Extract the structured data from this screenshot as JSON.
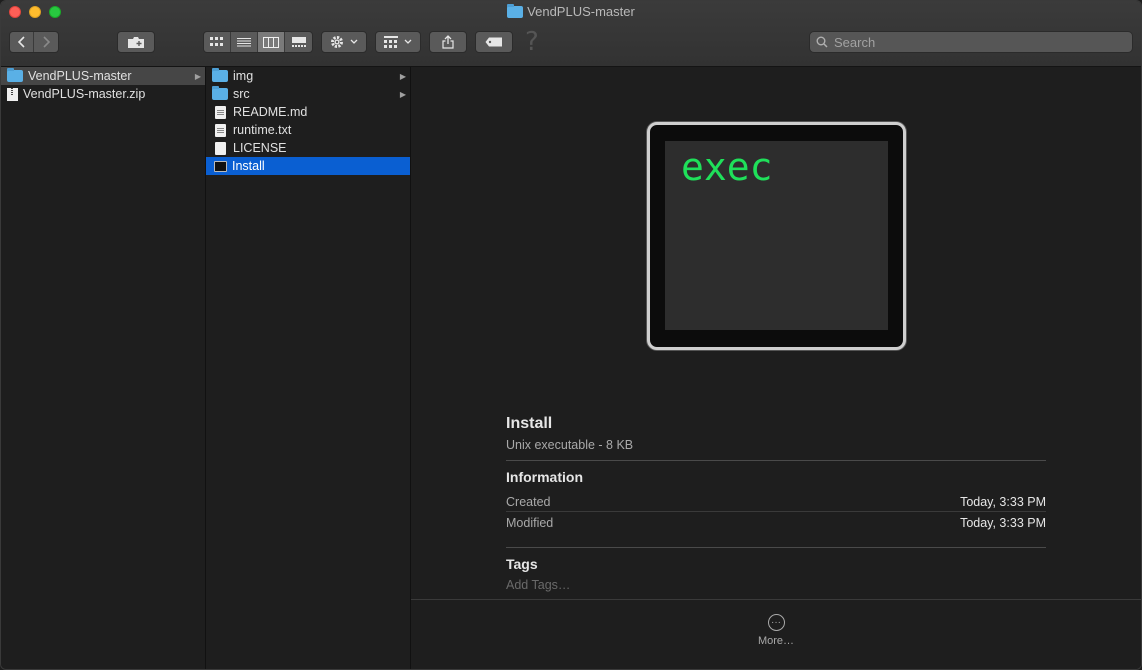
{
  "window": {
    "title": "VendPLUS-master"
  },
  "toolbar": {
    "search_placeholder": "Search",
    "help_glyph": "?"
  },
  "sidebar": {
    "items": [
      {
        "label": "VendPLUS-master",
        "type": "folder",
        "selected": true
      },
      {
        "label": "VendPLUS-master.zip",
        "type": "zip"
      }
    ]
  },
  "column2": {
    "items": [
      {
        "label": "img",
        "type": "folder"
      },
      {
        "label": "src",
        "type": "folder"
      },
      {
        "label": "README.md",
        "type": "doc"
      },
      {
        "label": "runtime.txt",
        "type": "doc"
      },
      {
        "label": "LICENSE",
        "type": "doc-blank"
      },
      {
        "label": "Install",
        "type": "exec",
        "selected": true
      }
    ]
  },
  "preview": {
    "icon_text": "exec",
    "name": "Install",
    "kind": "Unix executable - 8 KB",
    "information_heading": "Information",
    "created_label": "Created",
    "created_value": "Today, 3:33 PM",
    "modified_label": "Modified",
    "modified_value": "Today, 3:33 PM",
    "tags_heading": "Tags",
    "add_tags": "Add Tags…",
    "more_label": "More…"
  }
}
